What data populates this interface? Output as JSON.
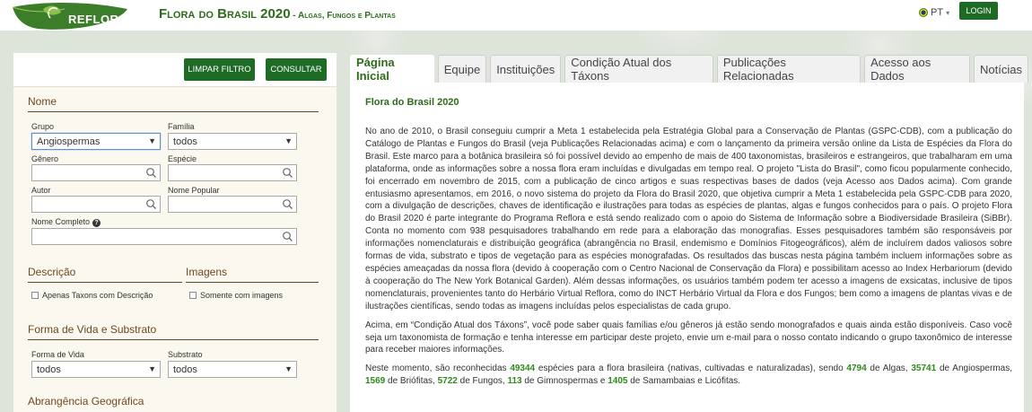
{
  "header": {
    "logo_text": "REFLORA",
    "title_main": "Flora do Brasil 2020",
    "title_sub": " - Algas, Fungos e Plantas",
    "lang": "PT",
    "login_label": "LOGIN"
  },
  "filters": {
    "limpar_label": "LIMPAR FILTRO",
    "consultar_label": "CONSULTAR",
    "nome": {
      "title": "Nome",
      "grupo_label": "Grupo",
      "grupo_value": "Angiospermas",
      "familia_label": "Família",
      "familia_value": "todos",
      "genero_label": "Gênero",
      "especie_label": "Espécie",
      "autor_label": "Autor",
      "nome_popular_label": "Nome Popular",
      "nome_completo_label": "Nome Completo"
    },
    "descricao": {
      "title": "Descrição",
      "checkbox_label": "Apenas Taxons com Descrição"
    },
    "imagens": {
      "title": "Imagens",
      "checkbox_label": "Somente com imagens"
    },
    "forma_vida": {
      "title": "Forma de Vida e Substrato",
      "forma_label": "Forma de Vida",
      "forma_value": "todos",
      "substrato_label": "Substrato",
      "substrato_value": "todos"
    },
    "abrangencia": {
      "title": "Abrangência Geográfica"
    }
  },
  "tabs": [
    {
      "label": "Página Inicial",
      "active": true
    },
    {
      "label": "Equipe",
      "active": false
    },
    {
      "label": "Instituições",
      "active": false
    },
    {
      "label": "Condição Atual dos Táxons",
      "active": false
    },
    {
      "label": "Publicações Relacionadas",
      "active": false
    },
    {
      "label": "Acesso aos Dados",
      "active": false
    },
    {
      "label": "Notícias",
      "active": false
    }
  ],
  "content": {
    "heading": "Flora do Brasil 2020",
    "paragraph1": "No ano de 2010, o Brasil conseguiu cumprir a Meta 1 estabelecida pela Estratégia Global para a Conservação de Plantas (GSPC-CDB), com a publicação do Catálogo de Plantas e Fungos do Brasil (veja Publicações Relacionadas acima) e com o lançamento da primeira versão online da Lista de Espécies da Flora do Brasil. Este marco para a botânica brasileira só foi possível devido ao empenho de mais de 400 taxonomistas, brasileiros e estrangeiros, que trabalharam em uma plataforma, onde as informações sobre a nossa flora eram incluídas e divulgadas em tempo real. O projeto \"Lista do Brasil\", como ficou popularmente conhecido, foi encerrado em novembro de 2015, com a publicação de cinco artigos e suas respectivas bases de dados (veja Acesso aos Dados acima). Com grande entusiasmo apresentamos, em 2016, o novo sistema do projeto da Flora do Brasil 2020, que objetiva cumprir a Meta 1 estabelecida pela GSPC-CDB para 2020, com a divulgação de descrições, chaves de identificação e ilustrações para todas as espécies de plantas, algas e fungos conhecidos para o país. O projeto Flora do Brasil 2020 é parte integrante do Programa Reflora e está sendo realizado com o apoio do Sistema de Informação sobre a Biodiversidade Brasileira (SiBBr). Conta no momento com 938 pesquisadores trabalhando em rede para a elaboração das monografias. Esses pesquisadores também são responsáveis por informações nomenclaturais e distribuição geográfica (abrangência no Brasil, endemismo e Domínios Fitogeográficos), além de incluírem dados valiosos sobre formas de vida, substrato e tipos de vegetação para as espécies monografadas. Os resultados das buscas nesta página também incluem informações sobre as espécies ameaçadas da nossa flora (devido à cooperação com o Centro Nacional de Conservação da Flora) e possibilitam acesso ao Index Herbariorum (devido à cooperação do The New York Botanical Garden). Além dessas informações, os usuários também podem ter acesso a imagens de exsicatas, inclusive de tipos nomenclaturais, provenientes tanto do Herbário Virtual Reflora, como do INCT Herbário Virtual da Flora e dos Fungos; bem como a imagens de plantas vivas e de ilustrações científicas, sendo todas as imagens incluídas pelos especialistas de cada grupo.",
    "paragraph2": "Acima, em “Condição Atual dos Táxons”, você pode saber quais famílias e/ou gêneros já estão sendo monografados e quais ainda estão disponíveis. Caso você seja um taxonomista de formação e tenha interesse em participar deste projeto, envie um e-mail para o nosso contato indicando o grupo taxonômico de interesse para receber maiores informações.",
    "p3_a": "Neste momento, são reconhecidas ",
    "p3_total": "49344",
    "p3_b": " espécies para a flora brasileira (nativas, cultivadas e naturalizadas), sendo ",
    "p3_algas": "4794",
    "p3_c": " de Algas, ",
    "p3_angio": "35741",
    "p3_d": " de Angiospermas, ",
    "p3_brio": "1569",
    "p3_e": " de Briófitas, ",
    "p3_fungos": "5722",
    "p3_f": " de Fungos, ",
    "p3_gimno": "113",
    "p3_g": " de Gimnospermas e ",
    "p3_samam": "1405",
    "p3_h": " de Samambaias e Licófitas."
  }
}
